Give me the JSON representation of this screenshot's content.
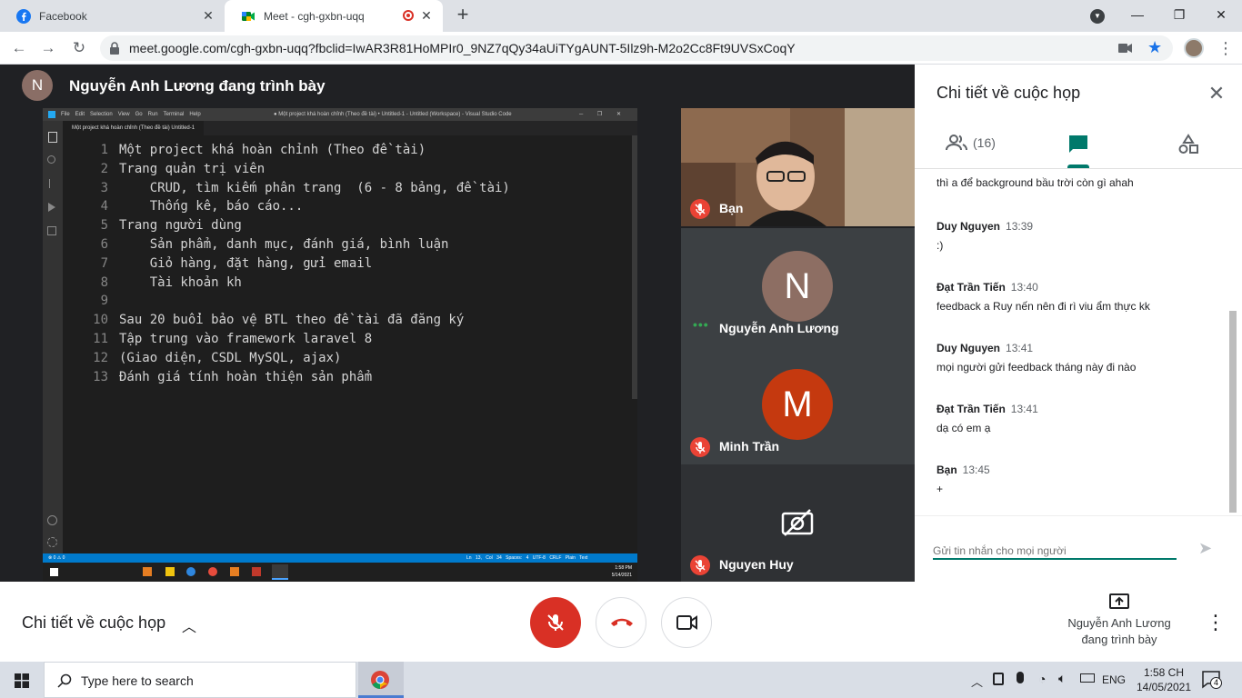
{
  "browser": {
    "tabs": [
      {
        "label": "Facebook",
        "active": false
      },
      {
        "label": "Meet - cgh-gxbn-uqq",
        "active": true,
        "recording": true
      }
    ],
    "url": "meet.google.com/cgh-gxbn-uqq?fbclid=IwAR3R81HoMPIr0_9NZ7qQy34aUiTYgAUNT-5Ilz9h-M2o2Cc8Ft9UVSxCoqY"
  },
  "meet": {
    "presenter_initial": "N",
    "presenter_label": "Nguyễn Anh Lương đang trình bày",
    "participants": [
      {
        "name": "Bạn",
        "muted": true,
        "has_video": true
      },
      {
        "name": "Nguyễn Anh Lương",
        "initial": "N",
        "color": "#8d6e63",
        "speaking": true
      },
      {
        "name": "Minh Trần",
        "initial": "M",
        "color": "#c5390f",
        "muted": true
      },
      {
        "name": "Nguyen Huy",
        "muted": true,
        "camera_off": true
      }
    ]
  },
  "screen_share": {
    "window_title": "● Một project khá hoàn chỉnh (Theo đề tài) • Untitled-1 - Untitled (Workspace) - Visual Studio Code",
    "menu": [
      "File",
      "Edit",
      "Selection",
      "View",
      "Go",
      "Run",
      "Terminal",
      "Help"
    ],
    "editor_tab": "Một project khá hoàn chỉnh (Theo đề tài)  Untitled-1",
    "lines": [
      {
        "n": "1",
        "text": "Một project khá hoàn chỉnh (Theo đề tài)"
      },
      {
        "n": "2",
        "text": "Trang quản trị viên"
      },
      {
        "n": "3",
        "text": "    CRUD, tìm kiếm phân trang  (6 - 8 bảng, đề tài)"
      },
      {
        "n": "4",
        "text": "    Thống kê, báo cáo..."
      },
      {
        "n": "5",
        "text": "Trang người dùng"
      },
      {
        "n": "6",
        "text": "    Sản phẩm, danh mục, đánh giá, bình luận"
      },
      {
        "n": "7",
        "text": "    Giỏ hàng, đặt hàng, gửi email"
      },
      {
        "n": "8",
        "text": "    Tài khoản kh"
      },
      {
        "n": "9",
        "text": ""
      },
      {
        "n": "10",
        "text": "Sau 20 buổi bảo vệ BTL theo đề tài đã đăng ký"
      },
      {
        "n": "11",
        "text": "Tập trung vào framework laravel 8"
      },
      {
        "n": "12",
        "text": "(Giao diện, CSDL MySQL, ajax)"
      },
      {
        "n": "13",
        "text": "Đánh giá tính hoàn thiện sản phẩm"
      }
    ],
    "status_left": "⊗ 0 ⚠ 0",
    "status_right": "Ln 13, Col 34   Spaces: 4   UTF-8   CRLF   Plain Text",
    "clock": "1:58 PM",
    "date": "5/14/2021"
  },
  "panel": {
    "title": "Chi tiết về cuộc họp",
    "people_count": "(16)",
    "messages": [
      {
        "sender": "",
        "time": "",
        "text": "thì a để background bầu trời còn gì ahah"
      },
      {
        "sender": "Duy Nguyen",
        "time": "13:39",
        "text": ":)"
      },
      {
        "sender": "Đạt Trần Tiến",
        "time": "13:40",
        "text": "feedback a Ruy nến nên đi rì viu ẩm thực kk"
      },
      {
        "sender": "Duy Nguyen",
        "time": "13:41",
        "text": "mọi người gửi feedback tháng này đi nào"
      },
      {
        "sender": "Đạt Trần Tiến",
        "time": "13:41",
        "text": "dạ có em ạ"
      },
      {
        "sender": "Bạn",
        "time": "13:45",
        "text": "+"
      }
    ],
    "input_placeholder": "Gửi tin nhắn cho mọi người"
  },
  "bottombar": {
    "details_label": "Chi tiết về cuộc họp",
    "present_line1": "Nguyễn Anh Lương",
    "present_line2": "đang trình bày"
  },
  "taskbar": {
    "search_placeholder": "Type here to search",
    "language": "ENG",
    "time": "1:58 CH",
    "date": "14/05/2021",
    "notifications": "4"
  }
}
